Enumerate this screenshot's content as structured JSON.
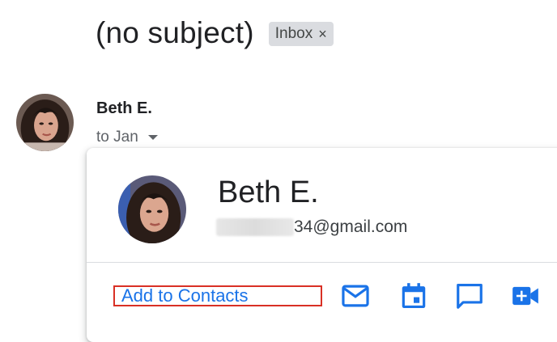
{
  "message": {
    "subject": "(no subject)",
    "label": {
      "text": "Inbox",
      "remove_glyph": "×"
    },
    "sender": {
      "name": "Beth E.",
      "avatar_icon": "profile-photo"
    },
    "recipients": "to Jan"
  },
  "contact_card": {
    "name": "Beth E.",
    "email_visible": "34@gmail.com",
    "add_contacts_label": "Add to Contacts",
    "actions": [
      {
        "name": "mail-icon"
      },
      {
        "name": "calendar-icon"
      },
      {
        "name": "chat-icon"
      },
      {
        "name": "video-call-icon"
      }
    ]
  },
  "colors": {
    "accent_blue": "#1a73e8",
    "highlight_red": "#d93025",
    "chip_bg": "#dadce0"
  }
}
